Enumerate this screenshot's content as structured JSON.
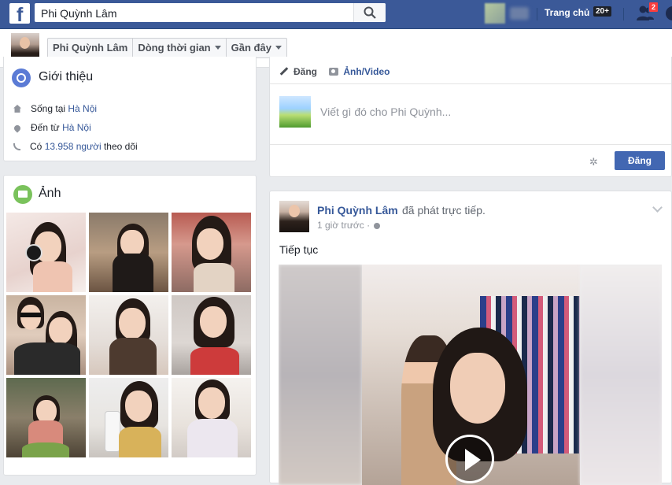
{
  "topbar": {
    "logo": "f",
    "search_value": "Phi Quỳnh Lâm",
    "home_label": "Trang chủ",
    "home_badge": "20+",
    "notif_count": "2",
    "brand_color": "#3b5998"
  },
  "profile_nav": {
    "name": "Phi Quỳnh Lâm",
    "timeline": "Dòng thời gian",
    "recent": "Gần đây"
  },
  "intro": {
    "title": "Giới thiệu",
    "lives_prefix": "Sống tại ",
    "lives_city": "Hà Nội",
    "from_prefix": "Đến từ ",
    "from_city": "Hà Nội",
    "followers_prefix": "Có ",
    "followers_count": "13.958",
    "followers_unit": " người",
    "followers_suffix": " theo dõi"
  },
  "photos": {
    "title": "Ảnh",
    "count_shown": 9
  },
  "composer": {
    "tab_post": "Đăng",
    "tab_photo": "Ảnh/Video",
    "placeholder": "Viết gì đó cho Phi Quỳnh...",
    "post_button": "Đăng"
  },
  "post": {
    "author": "Phi Quỳnh Lâm",
    "action": "đã phát trực tiếp.",
    "time": "1 giờ trước",
    "time_sep": " · ",
    "text": "Tiếp tục"
  },
  "colors": {
    "link": "#365899",
    "button": "#4267b2",
    "background": "#e9ebee"
  }
}
